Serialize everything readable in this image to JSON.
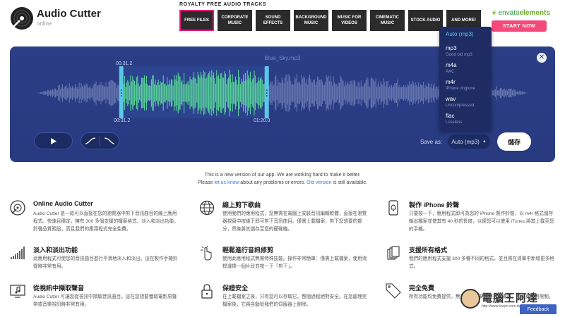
{
  "app": {
    "title": "Audio Cutter",
    "subtitle": "online"
  },
  "ad": {
    "heading": "ROYALTY FREE AUDIO TRACKS",
    "tiles": [
      "FREE FILES",
      "CORPORATE MUSIC",
      "SOUND EFFECTS",
      "BACKGROUND MUSIC",
      "MUSIC FOR VIDEOS",
      "CINEMATIC MUSIC",
      "STOCK AUDIO",
      "AND MORE!"
    ],
    "brand_prefix": "envato",
    "brand_suffix": "elements",
    "cta": "START NOW"
  },
  "editor": {
    "filename": "Blue_Sky.mp3",
    "start_time_top": "00:31.2",
    "start_time_bottom": "00:31.2",
    "end_time": "01:20.0",
    "save_as_label": "Save as:",
    "selected_format": "Auto (mp3)",
    "save_label": "儲存",
    "selection": {
      "start_fraction": 0.172,
      "end_fraction": 0.468
    }
  },
  "formats": [
    {
      "name": "Auto (mp3)",
      "desc": ""
    },
    {
      "name": "mp3",
      "desc": "Good old mp3"
    },
    {
      "name": "m4a",
      "desc": "AAC"
    },
    {
      "name": "m4r",
      "desc": "iPhone ringtone"
    },
    {
      "name": "wav",
      "desc": "Uncompressed"
    },
    {
      "name": "flac",
      "desc": "Lossless"
    }
  ],
  "notice": {
    "line1": "This is a new version of our app. We are working hard to make it better.",
    "line2_a": "Please ",
    "line2_link1": "let us know",
    "line2_b": " about any problems or errors. ",
    "line2_link2": "Old version",
    "line2_c": " is still available."
  },
  "features": [
    {
      "title": "Online Audio Cutter",
      "desc": "Audio Cutter 是一款可以直接在您的瀏覽器中剪下音訊曲目的線上應用程式。快速且穩定，擁有 300 多個支援的檔案格式、淡入和淡出功能，鈴聲品質預設，而且我們的應用程式完全免費。"
    },
    {
      "title": "線上剪下歌曲",
      "desc": "使用我們的應用程式，您無需在電腦上安裝音訊編輯軟體，直接在瀏覽器視窗中按幾下即可剪下音訊曲目。僅需上載檔案，剪下您想要的部分，然後將其儲存至您的硬碟機。"
    },
    {
      "title": "製作 iPhone 鈴聲",
      "desc": "只要按一下，應用程式即可為您的 iPhone 製作鈴聲，以 m4r 格式儲存輸出檔案並使其有 40 秒的長度，以便您可以使用 iTunes 將其上載至您的手機。"
    },
    {
      "title": "淡入和淡出功能",
      "desc": "此應用程式可使您的音訊曲目進行平滑地淡入和淡出。這在製作手機鈴聲時非常有用。"
    },
    {
      "title": "輕鬆進行音訊修剪",
      "desc": "使用此應用程式無需特殊技能。操作非常簡單：僅需上載檔案，使用滑桿選擇一個片段並按一下「剪下」。"
    },
    {
      "title": "支援所有格式",
      "desc": "我們的應用程式支援 300 多種不同的格式，並且將在清單中新增更多格式。"
    },
    {
      "title": "從視訊中擷取聲音",
      "desc": "Audio Cutter 可讓您從視訊中擷取音訊曲目。這在您想要獲取電影原聲帶或音樂視訊時非常有用。"
    },
    {
      "title": "保證安全",
      "desc": "在上載檔案之後，只有您可以存取它。整個過程絕對安全。在您處理完檔案後，它將自動從我們的伺服器上刪除。"
    },
    {
      "title": "完全免費",
      "desc": "所有功能均免費提供，無需註冊、安裝程式或購買，也沒有任何限制。"
    }
  ],
  "feedback_label": "Feedback",
  "watermark": {
    "text": "電腦王阿達",
    "url": "http://www.kocpc.com.tw"
  },
  "colors": {
    "accent": "#2b3e86",
    "selection": "#5bdc9a",
    "wave_idle": "#7f8fc2",
    "handle": "#5bc6e8",
    "link": "#3a7bd5",
    "cta": "#f34a7a"
  }
}
